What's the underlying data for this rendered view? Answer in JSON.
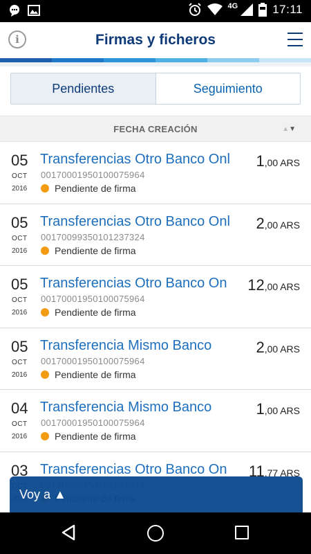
{
  "status_bar": {
    "time": "17:11",
    "network": "4G",
    "icons": [
      "chat-bubble-icon",
      "image-icon",
      "alarm-icon",
      "wifi-icon",
      "cell-signal-icon",
      "battery-icon"
    ]
  },
  "header": {
    "title": "Firmas y ficheros",
    "info_icon": "i",
    "stripe_colors": [
      "#1b5fad",
      "#1f78c8",
      "#2f95da",
      "#4fb0e6",
      "#8ccdf0",
      "#c6e6f7"
    ]
  },
  "tabs": [
    {
      "label": "Pendientes",
      "active": true
    },
    {
      "label": "Seguimiento",
      "active": false
    }
  ],
  "sort": {
    "label": "FECHA CREACIÓN"
  },
  "transactions": [
    {
      "day": "05",
      "month": "OCT",
      "year": "2016",
      "title": "Transferencias Otro Banco Onl",
      "account": "00170001950100075964",
      "status": "Pendiente de firma",
      "amount_int": "1",
      "amount_dec": ",00",
      "currency": "ARS"
    },
    {
      "day": "05",
      "month": "OCT",
      "year": "2016",
      "title": "Transferencias Otro Banco Onl",
      "account": "00170099350101237324",
      "status": "Pendiente de firma",
      "amount_int": "2",
      "amount_dec": ",00",
      "currency": "ARS"
    },
    {
      "day": "05",
      "month": "OCT",
      "year": "2016",
      "title": "Transferencias Otro Banco On",
      "account": "00170001950100075964",
      "status": "Pendiente de firma",
      "amount_int": "12",
      "amount_dec": ",00",
      "currency": "ARS"
    },
    {
      "day": "05",
      "month": "OCT",
      "year": "2016",
      "title": "Transferencia Mismo Banco",
      "account": "00170001950100075964",
      "status": "Pendiente de firma",
      "amount_int": "2",
      "amount_dec": ",00",
      "currency": "ARS"
    },
    {
      "day": "04",
      "month": "OCT",
      "year": "2016",
      "title": "Transferencia Mismo Banco",
      "account": "00170001950100075964",
      "status": "Pendiente de firma",
      "amount_int": "1",
      "amount_dec": ",00",
      "currency": "ARS"
    },
    {
      "day": "03",
      "month": "OCT",
      "year": "2016",
      "title": "Transferencias Otro Banco On",
      "account": "00170099350101237324",
      "status": "Pendiente de firma",
      "amount_int": "11",
      "amount_dec": ",77",
      "currency": "ARS"
    }
  ],
  "floating": {
    "label": "Voy a ▲"
  },
  "colors": {
    "brand_dark": "#0f3a78",
    "link_blue": "#1d6fbe",
    "status_pending": "#f39c12"
  }
}
